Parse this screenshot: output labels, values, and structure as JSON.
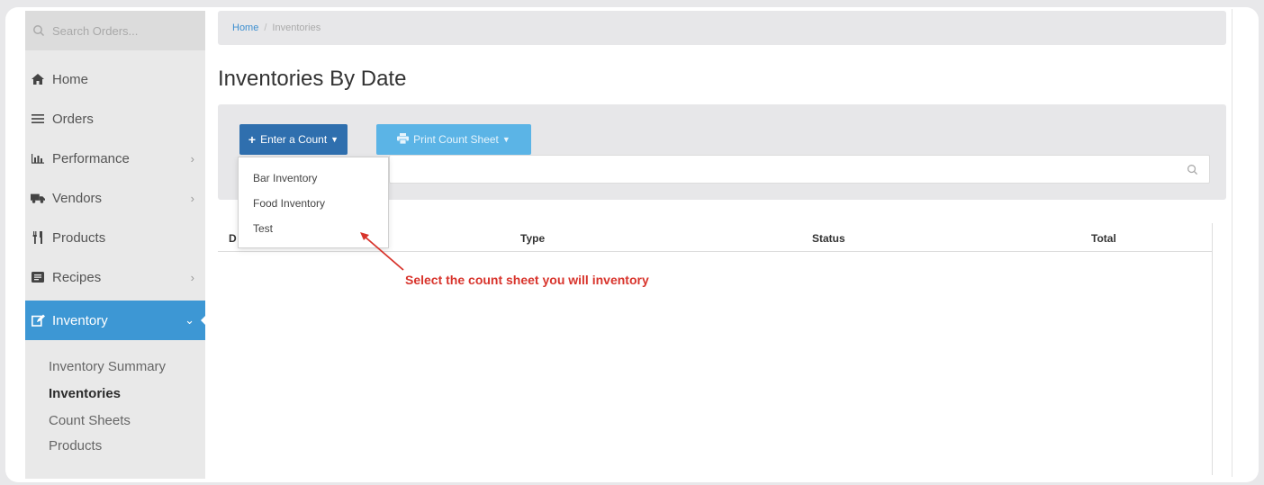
{
  "sidebar": {
    "search_placeholder": "Search Orders...",
    "items": [
      {
        "label": "Home",
        "icon": "home-icon"
      },
      {
        "label": "Orders",
        "icon": "list-icon"
      },
      {
        "label": "Performance",
        "icon": "bar-chart-icon",
        "chevron": "›"
      },
      {
        "label": "Vendors",
        "icon": "truck-icon",
        "chevron": "›"
      },
      {
        "label": "Products",
        "icon": "cutlery-icon"
      },
      {
        "label": "Recipes",
        "icon": "book-icon",
        "chevron": "›"
      },
      {
        "label": "Inventory",
        "icon": "edit-icon",
        "chevron": "⌄"
      }
    ],
    "subitems": [
      {
        "label": "Inventory Summary"
      },
      {
        "label": "Inventories"
      },
      {
        "label": "Count Sheets"
      },
      {
        "label": "Products"
      }
    ]
  },
  "breadcrumb": {
    "home": "Home",
    "separator": "/",
    "current": "Inventories"
  },
  "page": {
    "title": "Inventories By Date"
  },
  "toolbar": {
    "count_label": "Enter a Count",
    "print_label": "Print Count Sheet"
  },
  "dropdown": {
    "items": [
      "Bar Inventory",
      "Food Inventory",
      "Test"
    ]
  },
  "table": {
    "columns": [
      "D",
      "Type",
      "Status",
      "Total"
    ]
  },
  "annotation": {
    "text": "Select the count sheet you will inventory"
  },
  "colors": {
    "accent": "#3d97d4",
    "primary_button": "#2f6fae",
    "secondary_button": "#5bb4e6",
    "annotation": "#d8342c"
  }
}
